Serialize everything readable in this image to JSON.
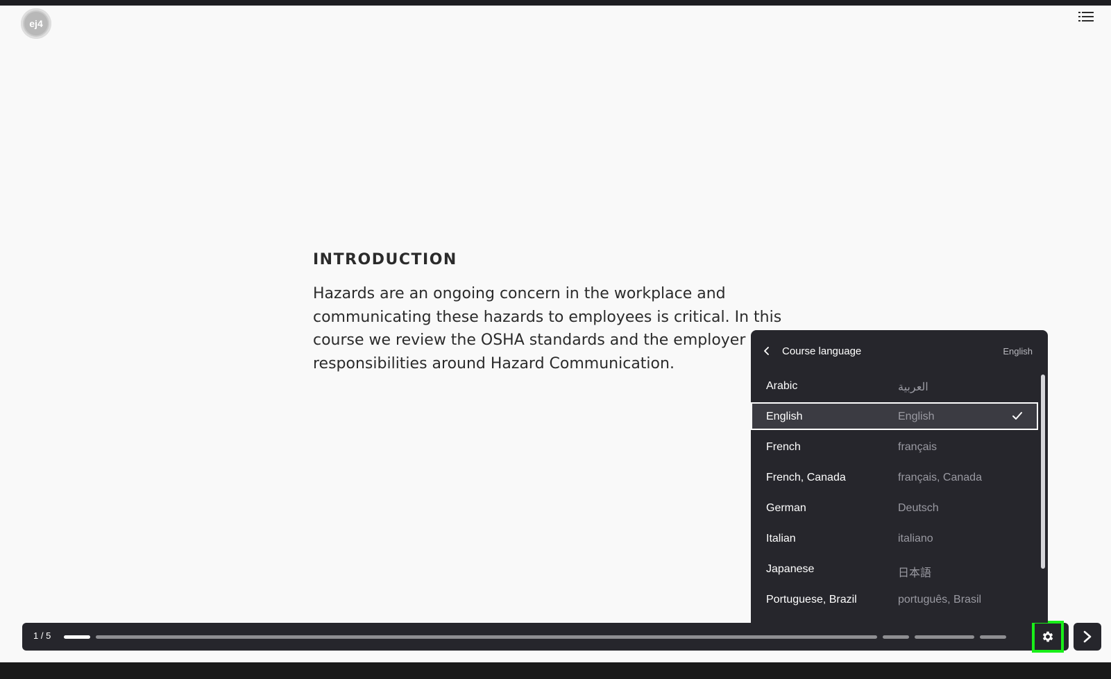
{
  "slide": {
    "heading": "INTRODUCTION",
    "body": "Hazards are an ongoing concern in the workplace and communicating these hazards to employees is critical. In this course we review the OSHA standards and the employer responsibilities around Hazard Communication."
  },
  "logo": {
    "text": "ej4"
  },
  "icons": {
    "menu": "list-menu-icon",
    "settings": "gear-icon",
    "next": "chevron-right-icon",
    "back": "chevron-left-icon",
    "check": "checkmark-icon"
  },
  "controls": {
    "page_counter": "1 / 5",
    "progress": {
      "current_page": 1,
      "total_pages": 5
    }
  },
  "language_panel": {
    "title": "Course language",
    "current": "English",
    "items": [
      {
        "name": "Arabic",
        "native": "العربية",
        "selected": false
      },
      {
        "name": "English",
        "native": "English",
        "selected": true
      },
      {
        "name": "French",
        "native": "français",
        "selected": false
      },
      {
        "name": "French, Canada",
        "native": "français, Canada",
        "selected": false
      },
      {
        "name": "German",
        "native": "Deutsch",
        "selected": false
      },
      {
        "name": "Italian",
        "native": "italiano",
        "selected": false
      },
      {
        "name": "Japanese",
        "native": "日本語",
        "selected": false
      },
      {
        "name": "Portuguese, Brazil",
        "native": "português, Brasil",
        "selected": false
      }
    ]
  },
  "colors": {
    "stage_background": "#f9f9f9",
    "panel_background": "#26262c",
    "highlight_border": "#19ef19",
    "text_dark": "#2b2b2b"
  }
}
